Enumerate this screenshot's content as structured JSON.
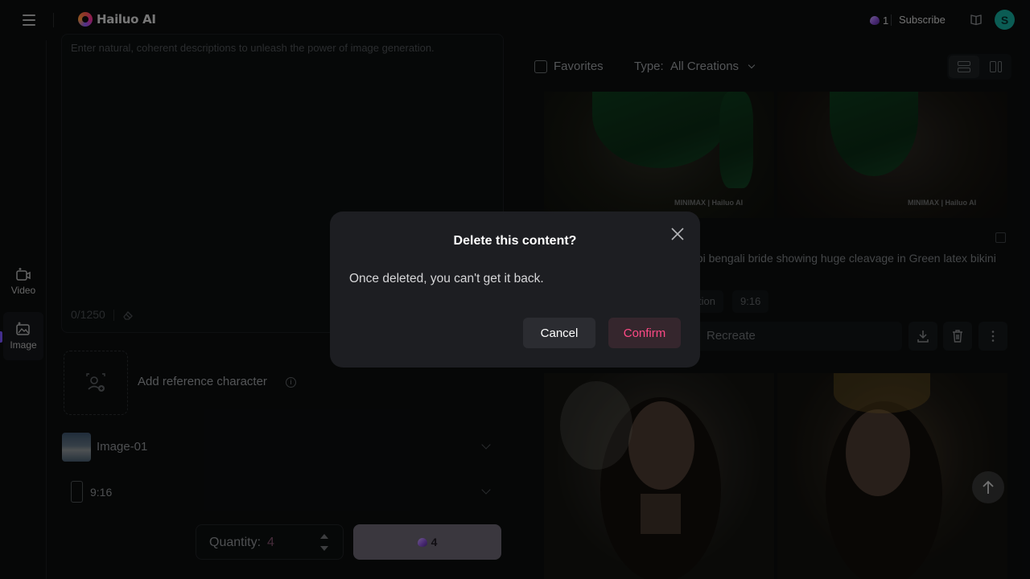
{
  "app": {
    "logo_text": "Hailuo AI"
  },
  "header": {
    "credits": "1",
    "subscribe_label": "Subscribe",
    "avatar_initial": "S"
  },
  "sidebar": {
    "items": [
      {
        "label": "Video",
        "icon": "video-icon"
      },
      {
        "label": "Image",
        "icon": "image-icon",
        "active": true
      }
    ]
  },
  "prompt": {
    "placeholder": "Enter natural, coherent descriptions to unleash the power of image generation.",
    "counter": "0/1250"
  },
  "reference": {
    "label": "Add reference character"
  },
  "model": {
    "name": "Image-01"
  },
  "aspect_ratio": {
    "value": "9:16"
  },
  "quantity": {
    "label": "Quantity:",
    "value": "4"
  },
  "generate": {
    "cost": "4"
  },
  "filters": {
    "favorites_label": "Favorites",
    "type_label": "Type:",
    "type_value": "All Creations"
  },
  "result": {
    "prompt_visible": "abi bengali bride showing huge cleavage in Green latex bikini",
    "tags": [
      "tion",
      "9:16"
    ],
    "recreate_label": "Recreate",
    "watermark": "MINIMAX | Hailuo AI"
  },
  "dialog": {
    "title": "Delete this content?",
    "message": "Once deleted, you can't get it back.",
    "cancel_label": "Cancel",
    "confirm_label": "Confirm"
  },
  "colors": {
    "background": "#0b0d0e",
    "dialog_bg": "#1d1e22",
    "confirm_text": "#ff4a86",
    "avatar": "#14a89a"
  }
}
